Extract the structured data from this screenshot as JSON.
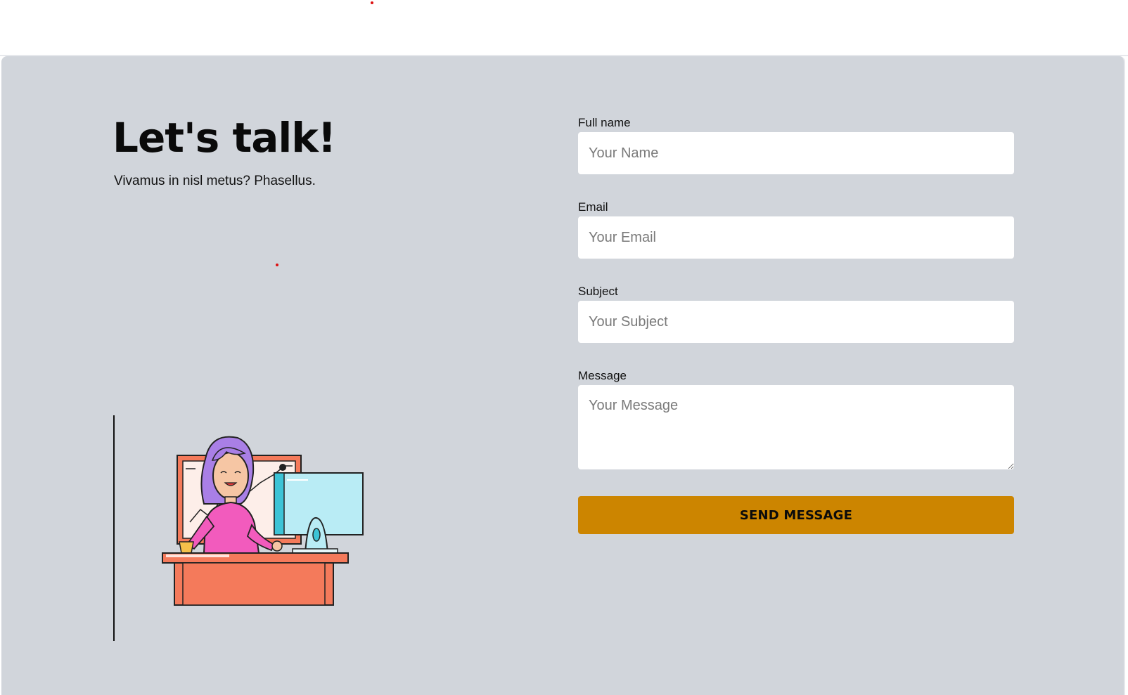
{
  "hero": {
    "title": "Let's talk!",
    "subtitle": "Vivamus in nisl metus? Phasellus."
  },
  "form": {
    "name": {
      "label": "Full name",
      "placeholder": "Your Name"
    },
    "email": {
      "label": "Email",
      "placeholder": "Your Email"
    },
    "subject": {
      "label": "Subject",
      "placeholder": "Your Subject"
    },
    "message": {
      "label": "Message",
      "placeholder": "Your Message"
    },
    "submit_label": "SEND MESSAGE"
  },
  "colors": {
    "section_bg": "#d1d5db",
    "button_bg": "#cc8500",
    "input_bg": "#ffffff"
  },
  "illustration": {
    "icon": "woman-at-desk-illustration"
  }
}
